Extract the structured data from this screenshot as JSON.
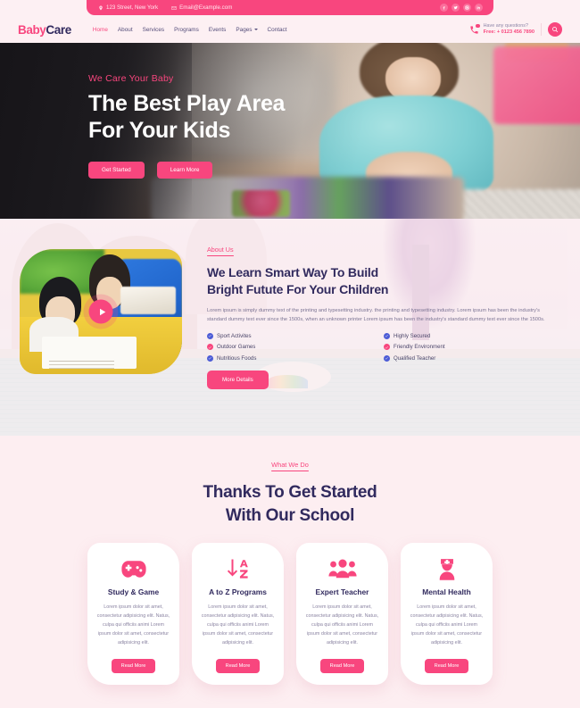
{
  "topbar": {
    "address": "123 Street, New York",
    "address_icon": "location-pin-icon",
    "email": "Email@Example.com",
    "email_icon": "envelope-icon",
    "socials": [
      {
        "name": "facebook-icon",
        "label": "Facebook"
      },
      {
        "name": "twitter-icon",
        "label": "Twitter"
      },
      {
        "name": "instagram-icon",
        "label": "Instagram"
      },
      {
        "name": "linkedin-icon",
        "label": "LinkedIn"
      }
    ]
  },
  "header": {
    "logo_part1": "Baby",
    "logo_part2": "Care",
    "nav": [
      {
        "label": "Home",
        "active": true
      },
      {
        "label": "About",
        "active": false
      },
      {
        "label": "Services",
        "active": false
      },
      {
        "label": "Programs",
        "active": false
      },
      {
        "label": "Events",
        "active": false
      },
      {
        "label": "Pages",
        "active": false,
        "dropdown": true
      },
      {
        "label": "Contact",
        "active": false
      }
    ],
    "questions_label": "Have any questions?",
    "phone": "Free: + 0123 456 7890",
    "search_icon": "search-icon"
  },
  "hero": {
    "subtitle": "We Care Your Baby",
    "title_line1": "The Best Play Area",
    "title_line2": "For Your Kids",
    "primary_button": "Get Started",
    "secondary_button": "Learn More"
  },
  "about": {
    "eyebrow": "About Us",
    "heading_line1": "We Learn Smart Way To Build",
    "heading_line2": "Bright Futute For Your Children",
    "paragraph": "Lorem ipsum is simply dummy text of the printing and typesetting industry. the printing and typesetting industry. Lorem ipsum has been the industry's standard dummy text ever since the 1500s, when an unknown printer Lorem ipsum has been the industry's standard dummy text ever since the 1500s.",
    "play_icon": "play-button-icon",
    "features": [
      {
        "label": "Sport Activites",
        "color": "blue"
      },
      {
        "label": "Highly Secured",
        "color": "blue"
      },
      {
        "label": "Outdoor Games",
        "color": "pink"
      },
      {
        "label": "Friendly Environment",
        "color": "pink"
      },
      {
        "label": "Nutritious Foods",
        "color": "blue"
      },
      {
        "label": "Qualified Teacher",
        "color": "blue"
      }
    ],
    "button": "More Details"
  },
  "what_we_do": {
    "eyebrow": "What We Do",
    "heading_line1": "Thanks To Get Started",
    "heading_line2": "With Our School",
    "cards": [
      {
        "icon": "gamepad-icon",
        "title": "Study & Game",
        "desc": "Lorem ipsum dolor sit amet, consectetur adipisicing elit. Natus, culpa qui officiis animi Lorem ipsum dolor sit amet, consectetur adipisicing elit.",
        "button": "Read More"
      },
      {
        "icon": "sort-alpha-down-icon",
        "title": "A to Z Programs",
        "desc": "Lorem ipsum dolor sit amet, consectetur adipisicing elit. Natus, culpa qui officiis animi Lorem ipsum dolor sit amet, consectetur adipisicing elit.",
        "button": "Read More"
      },
      {
        "icon": "users-group-icon",
        "title": "Expert Teacher",
        "desc": "Lorem ipsum dolor sit amet, consectetur adipisicing elit. Natus, culpa qui officiis animi Lorem ipsum dolor sit amet, consectetur adipisicing elit.",
        "button": "Read More"
      },
      {
        "icon": "nurse-icon",
        "title": "Mental Health",
        "desc": "Lorem ipsum dolor sit amet, consectetur adipisicing elit. Natus, culpa qui officiis animi Lorem ipsum dolor sit amet, consectetur adipisicing elit.",
        "button": "Read More"
      }
    ]
  },
  "colors": {
    "primary_pink": "#f8467e",
    "dark_navy": "#312a5e",
    "blue_check": "#4c5cd6",
    "page_bg": "#fdf0f3",
    "section_bg": "#fdeef1"
  }
}
